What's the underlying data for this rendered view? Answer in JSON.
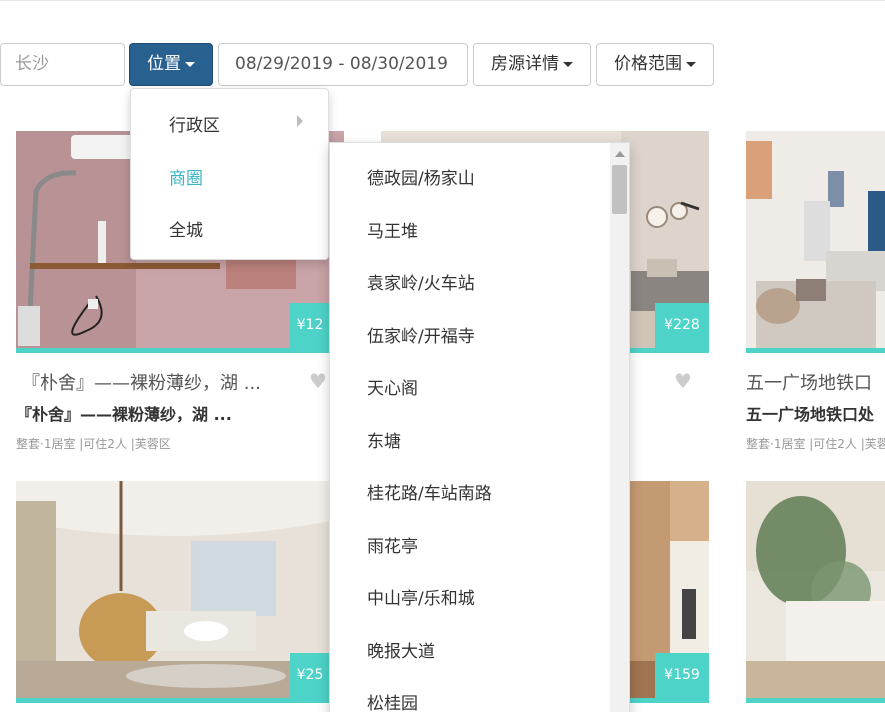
{
  "filters": {
    "city": "长沙",
    "location_label": "位置",
    "date_range": "08/29/2019 - 08/30/2019",
    "house_detail_label": "房源详情",
    "price_range_label": "价格范围"
  },
  "location_menu": {
    "items": [
      {
        "label": "行政区",
        "has_submenu": true
      },
      {
        "label": "商圈",
        "active": true
      },
      {
        "label": "全城"
      }
    ]
  },
  "area_submenu": {
    "items": [
      "德政园/杨家山",
      "马王堆",
      "袁家岭/火车站",
      "伍家岭/开福寺",
      "天心阁",
      "东塘",
      "桂花路/车站南路",
      "雨花亭",
      "中山亭/乐和城",
      "晚报大道",
      "松桂园"
    ]
  },
  "listings": [
    {
      "price": "¥12",
      "title": "『朴舍』——裸粉薄纱，湖 ...",
      "subtitle": "『朴舍』——裸粉薄纱，湖 ...",
      "meta": "整套·1居室 |可住2人 |芙蓉区"
    },
    {
      "price": "¥228",
      "title": "",
      "subtitle": "",
      "meta": ""
    },
    {
      "price": "",
      "title": "五一广场地铁口",
      "subtitle": "五一广场地铁口处",
      "meta": "整套·1居室 |可住2人 |芙蓉"
    },
    {
      "price": "¥25",
      "title": "",
      "subtitle": "",
      "meta": ""
    },
    {
      "price": "¥159",
      "title": "",
      "subtitle": "",
      "meta": ""
    }
  ],
  "colors": {
    "primary": "#286090",
    "accent": "#4ed3c9",
    "active_menu": "#3bb5c6"
  }
}
